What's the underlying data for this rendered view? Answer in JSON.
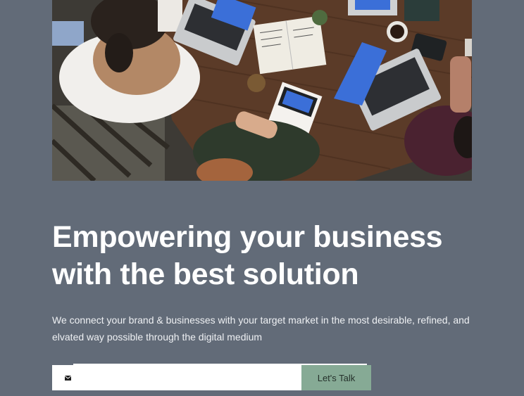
{
  "hero": {
    "image_icon": "team-meeting-photo"
  },
  "headline": {
    "line1": "Empowering your business",
    "line2": "with the best solution"
  },
  "subtext": {
    "line1": "We connect your brand & businesses with your target market in the most desirable, refined, and",
    "line2": "elvated way possible through the digital medium"
  },
  "form": {
    "email_icon": "envelope-icon",
    "email_value": "",
    "email_placeholder": "",
    "button_label": "Let's Talk"
  },
  "colors": {
    "background": "#626b78",
    "button": "#86aa95",
    "text": "#ffffff"
  }
}
